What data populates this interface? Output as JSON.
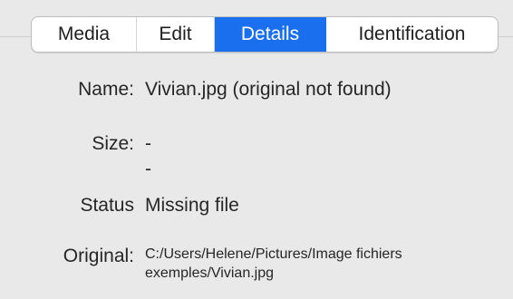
{
  "tabs": {
    "media": "Media",
    "edit": "Edit",
    "details": "Details",
    "identification": "Identification",
    "active": "Details",
    "active_color": "#1a6fef"
  },
  "fields": {
    "name_label": "Name:",
    "name_value": "Vivian.jpg (original not found)",
    "size_label": "Size:",
    "size_value_1": "-",
    "size_value_2": "-",
    "status_label": "Status",
    "status_value": "Missing file",
    "original_label": "Original:",
    "original_value": "C:/Users/Helene/Pictures/Image fichiers exemples/Vivian.jpg"
  }
}
